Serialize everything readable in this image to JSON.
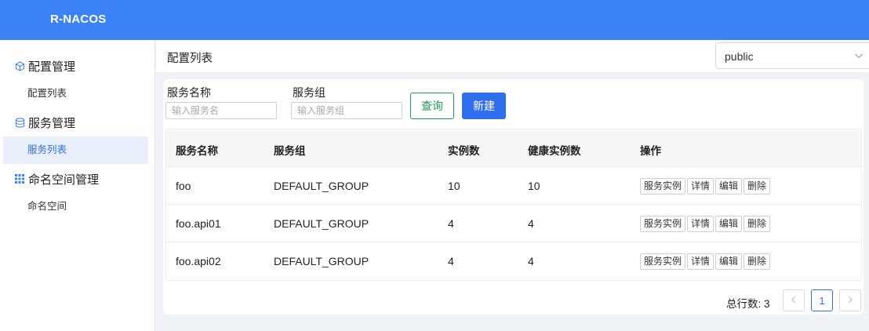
{
  "app": {
    "brand": "R-NACOS"
  },
  "sidebar": {
    "groups": [
      {
        "label": "配置管理",
        "icon": "cube-icon",
        "items": [
          {
            "label": "配置列表"
          }
        ]
      },
      {
        "label": "服务管理",
        "icon": "database-icon",
        "items": [
          {
            "label": "服务列表",
            "active": true
          }
        ]
      },
      {
        "label": "命名空间管理",
        "icon": "grid-icon",
        "items": [
          {
            "label": "命名空间"
          }
        ]
      }
    ]
  },
  "header": {
    "title": "配置列表",
    "namespace": {
      "value": "public",
      "icon": "chevron-down-icon"
    }
  },
  "filters": {
    "service_name_label": "服务名称",
    "service_name_placeholder": "输入服务名",
    "group_label": "服务组",
    "group_placeholder": "输入服务组",
    "query_label": "查询",
    "new_label": "新建"
  },
  "table": {
    "columns": [
      "服务名称",
      "服务组",
      "实例数",
      "健康实例数",
      "操作"
    ],
    "rows": [
      {
        "name": "foo",
        "group": "DEFAULT_GROUP",
        "instances": "10",
        "healthy": "10"
      },
      {
        "name": "foo.api01",
        "group": "DEFAULT_GROUP",
        "instances": "4",
        "healthy": "4"
      },
      {
        "name": "foo.api02",
        "group": "DEFAULT_GROUP",
        "instances": "4",
        "healthy": "4"
      }
    ],
    "row_actions": [
      "服务实例",
      "详情",
      "编辑",
      "删除"
    ]
  },
  "pagination": {
    "total_text": "总行数: 3",
    "current_page": "1",
    "prev_icon": "chevron-left-icon",
    "next_icon": "chevron-right-icon"
  },
  "colors": {
    "topbar": "#3b82f6",
    "primary": "#2f6fed",
    "query": "#1e9b53",
    "active_bg": "#e8effa"
  }
}
